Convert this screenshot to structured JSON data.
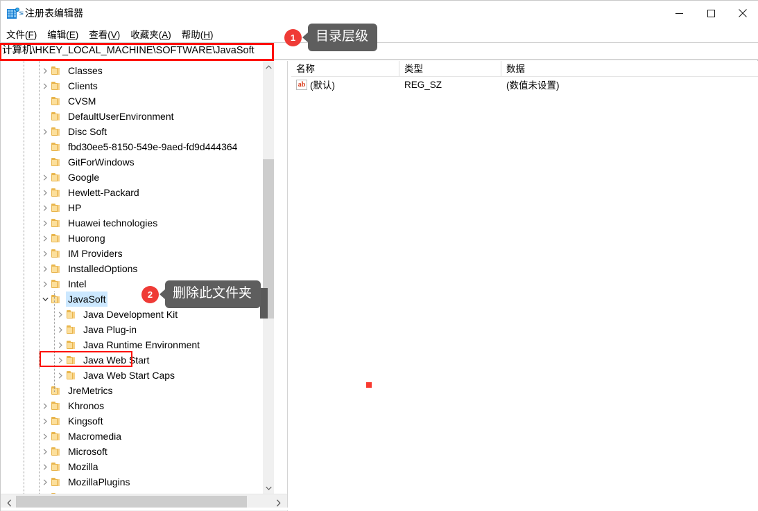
{
  "window": {
    "title": "注册表编辑器",
    "icon": "registry-editor-icon",
    "controls": {
      "minimize": "−",
      "maximize": "□",
      "close": "✕"
    }
  },
  "menubar": {
    "items": [
      {
        "label": "文件(F)",
        "text": "文件(",
        "key": "F",
        "tail": ")"
      },
      {
        "label": "编辑(E)",
        "text": "编辑(",
        "key": "E",
        "tail": ")"
      },
      {
        "label": "查看(V)",
        "text": "查看(",
        "key": "V",
        "tail": ")"
      },
      {
        "label": "收藏夹(A)",
        "text": "收藏夹(",
        "key": "A",
        "tail": ")"
      },
      {
        "label": "帮助(H)",
        "text": "帮助(",
        "key": "H",
        "tail": ")"
      }
    ]
  },
  "address": {
    "value": "计算机\\HKEY_LOCAL_MACHINE\\SOFTWARE\\JavaSoft",
    "highlight_color": "#fd1100"
  },
  "tree": {
    "items": [
      {
        "label": "Classes",
        "indent": 1,
        "expander": "collapsed",
        "selected": false
      },
      {
        "label": "Clients",
        "indent": 1,
        "expander": "collapsed",
        "selected": false
      },
      {
        "label": "CVSM",
        "indent": 1,
        "expander": "leaf",
        "selected": false
      },
      {
        "label": "DefaultUserEnvironment",
        "indent": 1,
        "expander": "leaf",
        "selected": false
      },
      {
        "label": "Disc Soft",
        "indent": 1,
        "expander": "collapsed",
        "selected": false
      },
      {
        "label": "fbd30ee5-8150-549e-9aed-fd9d444364",
        "indent": 1,
        "expander": "leaf",
        "selected": false
      },
      {
        "label": "GitForWindows",
        "indent": 1,
        "expander": "leaf",
        "selected": false
      },
      {
        "label": "Google",
        "indent": 1,
        "expander": "collapsed",
        "selected": false
      },
      {
        "label": "Hewlett-Packard",
        "indent": 1,
        "expander": "collapsed",
        "selected": false
      },
      {
        "label": "HP",
        "indent": 1,
        "expander": "collapsed",
        "selected": false
      },
      {
        "label": "Huawei technologies",
        "indent": 1,
        "expander": "collapsed",
        "selected": false
      },
      {
        "label": "Huorong",
        "indent": 1,
        "expander": "collapsed",
        "selected": false
      },
      {
        "label": "IM Providers",
        "indent": 1,
        "expander": "collapsed",
        "selected": false
      },
      {
        "label": "InstalledOptions",
        "indent": 1,
        "expander": "collapsed",
        "selected": false
      },
      {
        "label": "Intel",
        "indent": 1,
        "expander": "collapsed",
        "selected": false
      },
      {
        "label": "JavaSoft",
        "indent": 1,
        "expander": "expanded",
        "selected": true
      },
      {
        "label": "Java Development Kit",
        "indent": 2,
        "expander": "collapsed",
        "selected": false
      },
      {
        "label": "Java Plug-in",
        "indent": 2,
        "expander": "collapsed",
        "selected": false
      },
      {
        "label": "Java Runtime Environment",
        "indent": 2,
        "expander": "collapsed",
        "selected": false
      },
      {
        "label": "Java Web Start",
        "indent": 2,
        "expander": "collapsed",
        "selected": false
      },
      {
        "label": "Java Web Start Caps",
        "indent": 2,
        "expander": "collapsed",
        "selected": false
      },
      {
        "label": "JreMetrics",
        "indent": 1,
        "expander": "leaf",
        "selected": false
      },
      {
        "label": "Khronos",
        "indent": 1,
        "expander": "collapsed",
        "selected": false
      },
      {
        "label": "Kingsoft",
        "indent": 1,
        "expander": "collapsed",
        "selected": false
      },
      {
        "label": "Macromedia",
        "indent": 1,
        "expander": "collapsed",
        "selected": false
      },
      {
        "label": "Microsoft",
        "indent": 1,
        "expander": "collapsed",
        "selected": false
      },
      {
        "label": "Mozilla",
        "indent": 1,
        "expander": "collapsed",
        "selected": false
      },
      {
        "label": "MozillaPlugins",
        "indent": 1,
        "expander": "collapsed",
        "selected": false
      },
      {
        "label": "",
        "indent": 1,
        "expander": "collapsed",
        "selected": false
      }
    ]
  },
  "list": {
    "columns": [
      "名称",
      "类型",
      "数据"
    ],
    "rows": [
      {
        "name": "(默认)",
        "type": "REG_SZ",
        "data": "(数值未设置)",
        "icon": "ab-string-icon"
      }
    ]
  },
  "annotations": [
    {
      "number": "1",
      "text": "目录层级"
    },
    {
      "number": "2",
      "text": "删除此文件夹"
    }
  ],
  "colors": {
    "accent_red": "#ef3b36",
    "box_red": "#fd1100",
    "bubble_gray": "#5e5e5e",
    "selection_blue": "#cce8ff",
    "folder_yellow": "#fcdf9b"
  }
}
